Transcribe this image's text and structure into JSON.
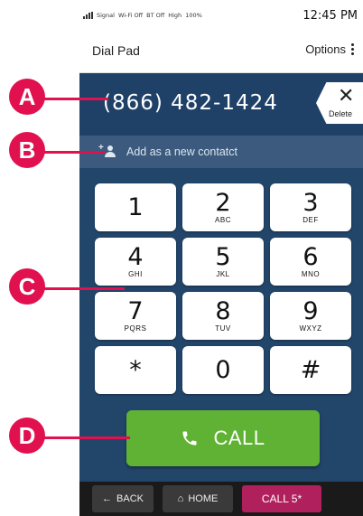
{
  "status_bar": {
    "signal": "Signal",
    "wifi": "Wi-Fi Off",
    "bluetooth": "BT Off",
    "volume": "High",
    "battery": "100%",
    "time": "12:45 PM"
  },
  "app_bar": {
    "title": "Dial Pad",
    "options_label": "Options"
  },
  "dialer": {
    "number": "(866) 482-1424",
    "delete_label": "Delete",
    "add_contact_label": "Add as a new contatct"
  },
  "keypad": [
    {
      "digit": "1",
      "letters": ""
    },
    {
      "digit": "2",
      "letters": "ABC"
    },
    {
      "digit": "3",
      "letters": "DEF"
    },
    {
      "digit": "4",
      "letters": "GHI"
    },
    {
      "digit": "5",
      "letters": "JKL"
    },
    {
      "digit": "6",
      "letters": "MNO"
    },
    {
      "digit": "7",
      "letters": "PQRS"
    },
    {
      "digit": "8",
      "letters": "TUV"
    },
    {
      "digit": "9",
      "letters": "WXYZ"
    },
    {
      "digit": "*",
      "letters": ""
    },
    {
      "digit": "0",
      "letters": ""
    },
    {
      "digit": "#",
      "letters": ""
    }
  ],
  "call_button": {
    "label": "CALL"
  },
  "bottom_nav": {
    "back_label": "BACK",
    "home_label": "HOME",
    "call5_label": "CALL 5*"
  },
  "callouts": [
    "A",
    "B",
    "C",
    "D"
  ],
  "colors": {
    "accent_callout": "#e0114e",
    "call_green": "#5fb233",
    "screen_blue": "#22456a",
    "call5_magenta": "#b0205c"
  }
}
